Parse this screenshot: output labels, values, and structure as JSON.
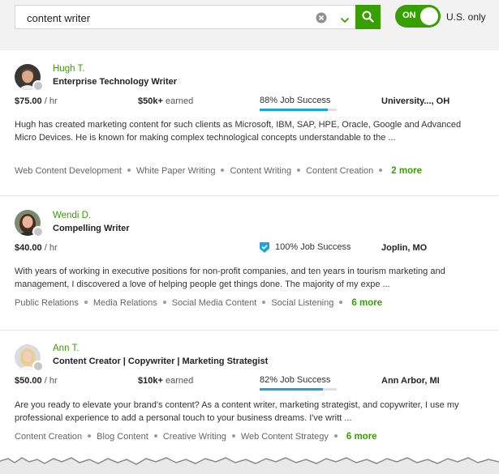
{
  "search": {
    "value": "content writer"
  },
  "toggle": {
    "label": "ON",
    "state": "on"
  },
  "filter_label": "U.S. only",
  "colors": {
    "brand_green": "#37a000",
    "job_success_blue": "#1fa3e0"
  },
  "freelancers": [
    {
      "name": "Hugh T.",
      "title": "Enterprise Technology Writer",
      "rate": "$75.00",
      "rate_unit": "/ hr",
      "earned_amount": "$50k+",
      "earned_label": "earned",
      "job_success": "88% Job Success",
      "job_success_pct": 88,
      "location": "University..., OH",
      "description": "Hugh has created marketing content for such clients as Microsoft, IBM, SAP, HPE, Oracle, Google and Advanced Micro Devices. He is known for making complex technological concepts understandable to the ...",
      "skills": [
        "Web Content Development",
        "White Paper Writing",
        "Content Writing",
        "Content Creation"
      ],
      "more": "2 more"
    },
    {
      "name": "Wendi D.",
      "title": "Compelling Writer",
      "rate": "$40.00",
      "rate_unit": "/ hr",
      "job_success": "100% Job Success",
      "job_success_icon": "top-rated-badge-icon",
      "location": "Joplin, MO",
      "description": "With years of working in executive positions for non-profit companies, and ten years in tourism marketing and management, I discovered a love of helping people get things done. The majority of my expe ...",
      "skills": [
        "Public Relations",
        "Media Relations",
        "Social Media Content",
        "Social Listening"
      ],
      "more": "6 more"
    },
    {
      "name": "Ann T.",
      "title": "Content Creator | Copywriter | Marketing Strategist",
      "rate": "$50.00",
      "rate_unit": "/ hr",
      "earned_amount": "$10k+",
      "earned_label": "earned",
      "job_success": "82% Job Success",
      "job_success_pct": 82,
      "location": "Ann Arbor, MI",
      "description": "Are you ready to elevate your brand's content? As a content writer, marketing strategist, and copywriter, I use my professional experience to add a personal touch to your business dreams. I've writt ...",
      "skills": [
        "Content Creation",
        "Blog Content",
        "Creative Writing",
        "Web Content Strategy"
      ],
      "more": "6 more"
    }
  ]
}
